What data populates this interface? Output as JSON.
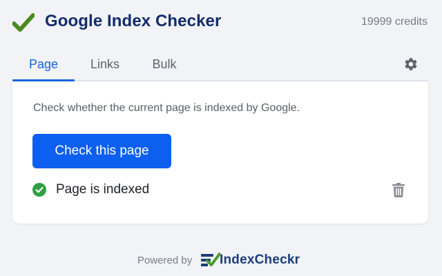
{
  "app": {
    "title": "Google Index Checker",
    "credits": "19999 credits",
    "logo_icon": "checkmark-icon",
    "logo_color": "#4a8a1c"
  },
  "tabs": [
    {
      "label": "Page",
      "active": true
    },
    {
      "label": "Links",
      "active": false
    },
    {
      "label": "Bulk",
      "active": false
    }
  ],
  "settings": {
    "icon": "gear-icon"
  },
  "main": {
    "description": "Check whether the current page is indexed by Google.",
    "check_button_label": "Check this page",
    "status": {
      "text": "Page is indexed",
      "icon": "success-check-icon",
      "color": "#2ea043"
    },
    "delete_icon": "trash-icon"
  },
  "footer": {
    "powered_by": "Powered by",
    "brand": "IndexCheckr"
  },
  "colors": {
    "accent": "#1565d8",
    "button": "#0d5ff0",
    "title": "#142c6b",
    "background": "#f1f3f6"
  }
}
